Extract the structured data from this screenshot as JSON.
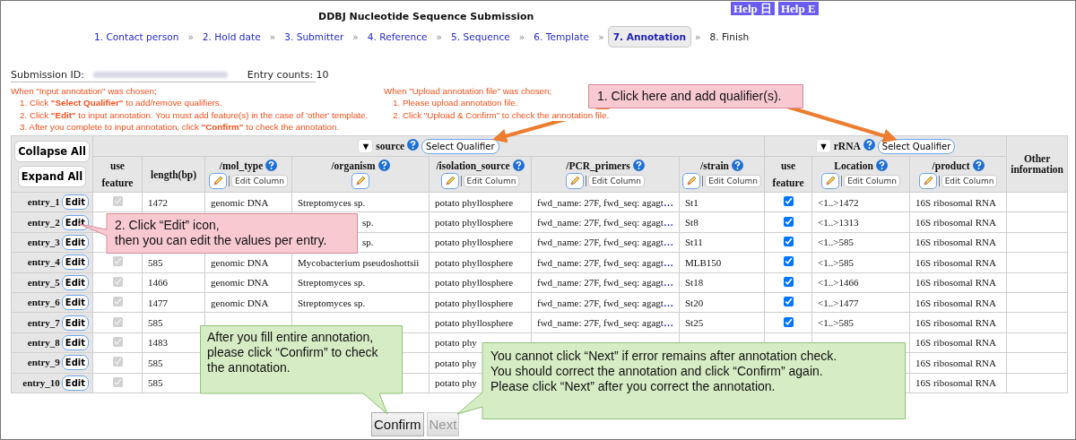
{
  "header": {
    "title": "DDBJ Nucleotide Sequence Submission",
    "help_buttons": [
      "Help 日",
      "Help E"
    ]
  },
  "steps": [
    {
      "label": "1. Contact person",
      "selected": false,
      "disabled": false
    },
    {
      "label": "2. Hold date",
      "selected": false,
      "disabled": false
    },
    {
      "label": "3. Submitter",
      "selected": false,
      "disabled": false
    },
    {
      "label": "4. Reference",
      "selected": false,
      "disabled": false
    },
    {
      "label": "5. Sequence",
      "selected": false,
      "disabled": false
    },
    {
      "label": "6. Template",
      "selected": false,
      "disabled": false
    },
    {
      "label": "7. Annotation",
      "selected": true,
      "disabled": false
    },
    {
      "label": "8. Finish",
      "selected": false,
      "disabled": true
    }
  ],
  "step_separators": [
    "»",
    "»",
    "»",
    "»",
    "»",
    "»",
    "»"
  ],
  "submission": {
    "id_label": "Submission ID:",
    "entry_counts": "Entry counts: 10"
  },
  "instructions": [
    {
      "heading": "When \"Input annotation\" was chosen;",
      "items": [
        "1. Click **\"Select Qualifier\"** to add/remove qualifiers.",
        "2. Click **\"Edit\"** to input annotation. You must add feature(s) in the case of 'other' template.",
        "3. After you complete to input annotation, click **\"Confirm\"** to check the annotation."
      ]
    },
    {
      "heading": "When \"Upload annotation file\" was chosen;",
      "items": [
        "1. Please upload annotation file.",
        "2. Click \"Upload & Confirm\" to check the annotation file."
      ]
    }
  ],
  "table": {
    "buttons": [
      "Collapse All",
      "Expand All"
    ],
    "groups": [
      {
        "toggle": "▼",
        "name": "source",
        "select": "Select Qualifier",
        "columns": [
          {
            "label": "use feature",
            "kind": "check",
            "disabled": true
          },
          {
            "label": "length(bp)",
            "kind": "plain"
          },
          {
            "label": "/mol_type",
            "kind": "qualifier",
            "edit_column": "Edit Column"
          },
          {
            "label": "/organism",
            "kind": "qualifier"
          },
          {
            "label": "/isolation_source",
            "kind": "qualifier",
            "edit_column": "Edit Column"
          },
          {
            "label": "/PCR_primers",
            "kind": "qualifier",
            "edit_column": "Edit Column"
          },
          {
            "label": "/strain",
            "kind": "qualifier",
            "edit_column": "Edit Column"
          }
        ]
      },
      {
        "toggle": "▼",
        "name": "rRNA",
        "select": "Select Qualifier",
        "columns": [
          {
            "label": "use feature",
            "kind": "check",
            "disabled": false
          },
          {
            "label": "Location",
            "kind": "qualifier",
            "edit_column": "Edit Column"
          },
          {
            "label": "/product",
            "kind": "qualifier",
            "edit_column": "Edit Column"
          }
        ]
      }
    ],
    "other_column": "Other information",
    "rows": [
      {
        "entry": "entry_1",
        "edit": "Edit",
        "cells": [
          [
            true,
            "1472",
            "genomic DNA",
            "Streptomyces sp.",
            "potato phyllosphere",
            {
              "text": "fwd_name: 27F, fwd_seq: agagt",
              "more": "…"
            },
            "St1"
          ],
          [
            true,
            "<1..>1472",
            "16S ribosomal RNA"
          ]
        ]
      },
      {
        "entry": "entry_2",
        "edit": "Edit",
        "cells": [
          [
            null,
            null,
            null,
            {
              "text": "sp.",
              "cut": true
            },
            "potato phyllosphere",
            {
              "text": "fwd_name: 27F, fwd_seq: agagt",
              "more": "…"
            },
            "St8"
          ],
          [
            true,
            "<1..>1313",
            "16S ribosomal RNA"
          ]
        ]
      },
      {
        "entry": "entry_3",
        "edit": "Edit",
        "cells": [
          [
            null,
            null,
            null,
            {
              "text": "sp.",
              "cut": true
            },
            "potato phyllosphere",
            {
              "text": "fwd_name: 27F, fwd_seq: agagt",
              "more": "…"
            },
            "St11"
          ],
          [
            true,
            "<1..>585",
            "16S ribosomal RNA"
          ]
        ]
      },
      {
        "entry": "entry_4",
        "edit": "Edit",
        "cells": [
          [
            true,
            "585",
            "genomic DNA",
            "Mycobacterium pseudoshottsii",
            "potato phyllosphere",
            {
              "text": "fwd_name: 27F, fwd_seq: agagt",
              "more": "…"
            },
            "MLB150"
          ],
          [
            true,
            "<1..>585",
            "16S ribosomal RNA"
          ]
        ]
      },
      {
        "entry": "entry_5",
        "edit": "Edit",
        "cells": [
          [
            true,
            "1466",
            "genomic DNA",
            "Streptomyces sp.",
            "potato phyllosphere",
            {
              "text": "fwd_name: 27F, fwd_seq: agagt",
              "more": "…"
            },
            "St18"
          ],
          [
            true,
            "<1..>1466",
            "16S ribosomal RNA"
          ]
        ]
      },
      {
        "entry": "entry_6",
        "edit": "Edit",
        "cells": [
          [
            true,
            "1477",
            "genomic DNA",
            "Streptomyces sp.",
            "potato phyllosphere",
            {
              "text": "fwd_name: 27F, fwd_seq: agagt",
              "more": "…"
            },
            "St20"
          ],
          [
            true,
            "<1..>1477",
            "16S ribosomal RNA"
          ]
        ]
      },
      {
        "entry": "entry_7",
        "edit": "Edit",
        "cells": [
          [
            true,
            "585",
            null,
            null,
            "potato phyllosphere",
            {
              "text": "fwd_name: 27F, fwd_seq: agagt",
              "more": "…"
            },
            "St25"
          ],
          [
            true,
            "<1..>585",
            "16S ribosomal RNA"
          ]
        ]
      },
      {
        "entry": "entry_8",
        "edit": "Edit",
        "cells": [
          [
            true,
            "1483",
            null,
            null,
            "potato phy",
            null,
            null
          ],
          [
            null,
            null,
            "16S ribosomal RNA"
          ]
        ]
      },
      {
        "entry": "entry_9",
        "edit": "Edit",
        "cells": [
          [
            true,
            "585",
            null,
            null,
            "potato phy",
            null,
            null
          ],
          [
            null,
            null,
            "16S ribosomal RNA"
          ]
        ]
      },
      {
        "entry": "entry_10",
        "edit": "Edit",
        "cells": [
          [
            true,
            "585",
            null,
            null,
            "potato phy",
            null,
            null
          ],
          [
            null,
            null,
            "16S ribosomal RNA"
          ]
        ]
      }
    ]
  },
  "buttons": [
    {
      "label": "Confirm",
      "disabled": false
    },
    {
      "label": "Next",
      "disabled": true
    }
  ],
  "callouts": [
    {
      "text": "1. Click here and add qualifier(s).",
      "color": "#f9c9d2"
    },
    {
      "text": "2. Click “Edit” icon,\nthen you can edit the values per entry.",
      "color": "#f9c9d2"
    },
    {
      "text": "After you fill entire annotation,\nplease click “Confirm” to check\nthe annotation.",
      "color": "#d6ecc4"
    },
    {
      "text": "You cannot click “Next” if error remains after annotation check.\nYou should correct the annotation and click “Confirm” again.\nPlease click “Next” after you correct the annotation.",
      "color": "#d6ecc4"
    }
  ]
}
